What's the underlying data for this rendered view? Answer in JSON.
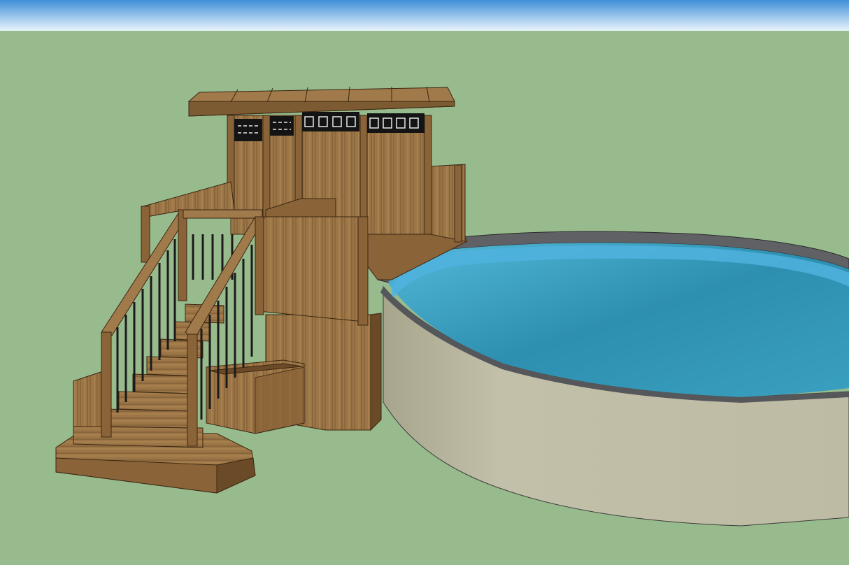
{
  "viewport": {
    "description_visible_text": "",
    "sky_color_top": "#3f8fd8",
    "sky_color_bottom": "#e9f4fc",
    "ground_color": "#98bb8e"
  },
  "scene": {
    "objects": [
      "deck-structure",
      "pergola-roof",
      "privacy-wall",
      "staircase",
      "railings",
      "planter-box",
      "above-ground-pool"
    ],
    "materials": {
      "wood_light": "#a07a4a",
      "wood_mid": "#8a6438",
      "wood_dark": "#6b4a28",
      "railing_black": "#1a1a1a",
      "pool_wall": "#bdbba3",
      "pool_wall_shadow": "#a7a58c",
      "pool_rim": "#5f6165",
      "water": "#2e8fb0",
      "water_light": "#53b9d8"
    }
  }
}
